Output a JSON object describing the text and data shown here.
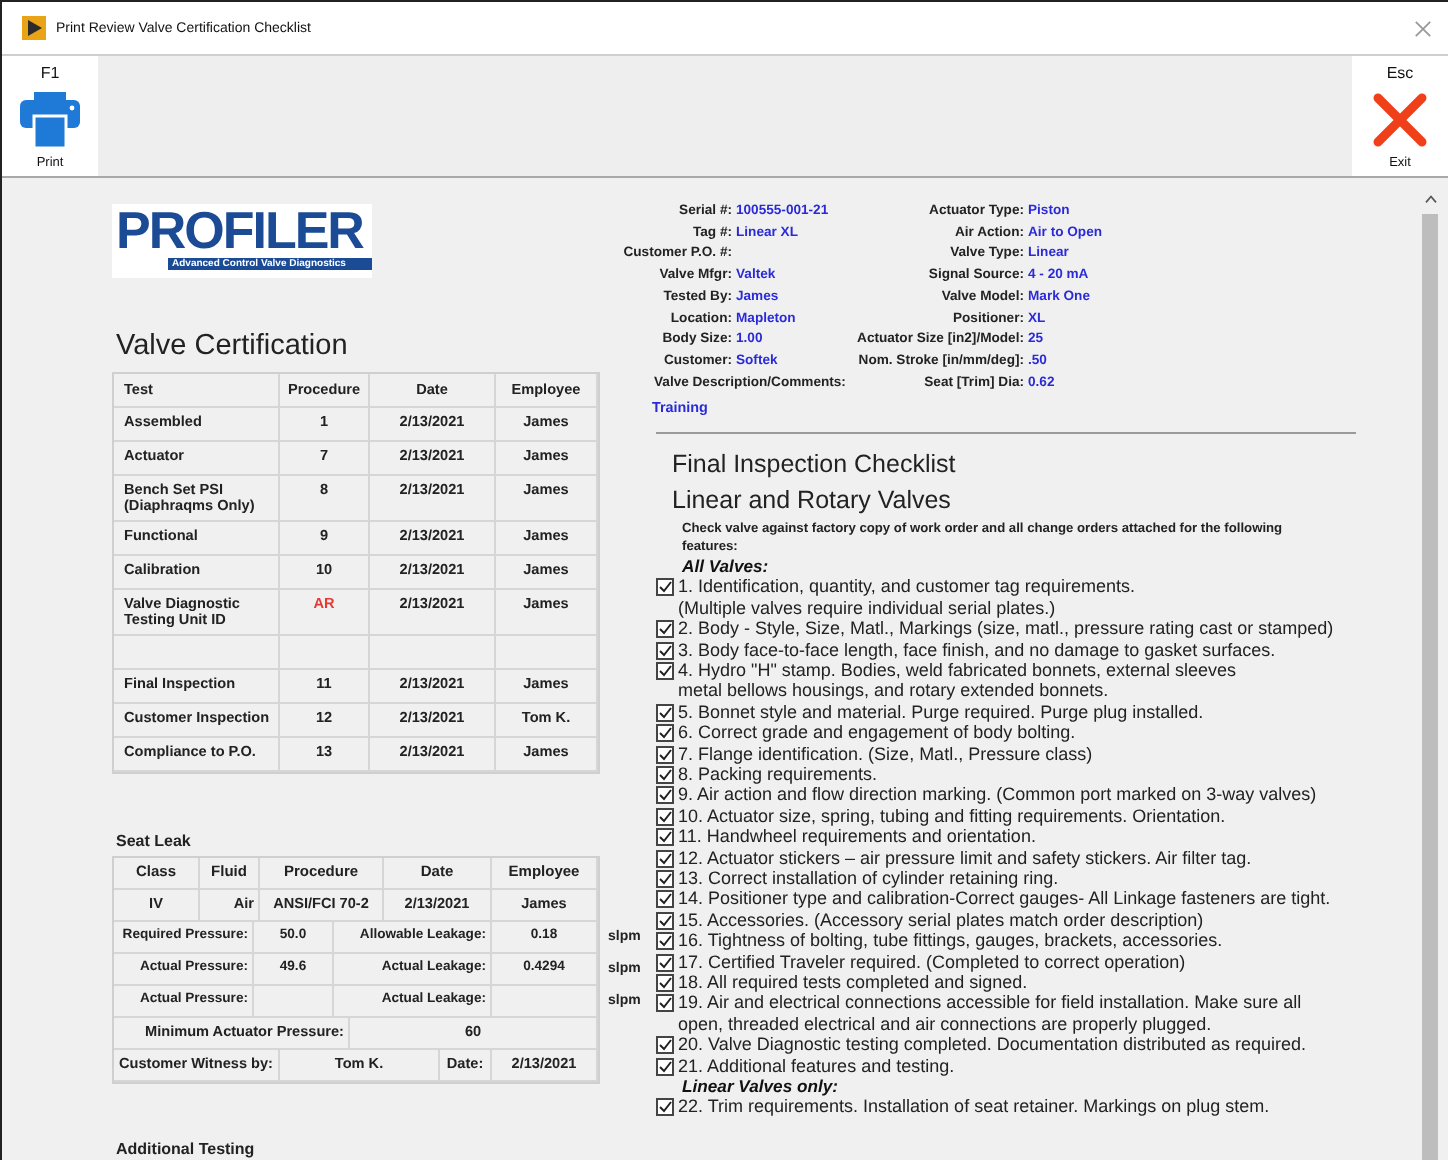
{
  "window": {
    "title": "Print Review Valve Certification Checklist"
  },
  "toolbar": {
    "buttons": [
      {
        "kind": "print",
        "key": "F1",
        "label": "Print"
      },
      {
        "kind": "exit",
        "key": "Esc",
        "label": "Exit"
      }
    ]
  },
  "logo": {
    "name": "PROFILER",
    "tagline": "Advanced Control Valve Diagnostics"
  },
  "certification": {
    "title": "Valve Certification",
    "columns": [
      "Test",
      "Procedure",
      "Date",
      "Employee"
    ],
    "rows": [
      {
        "kind": "entry",
        "test": "Assembled",
        "procedure": "1",
        "date": "2/13/2021",
        "employee": "James",
        "flagged": false
      },
      {
        "kind": "entry",
        "test": "Actuator",
        "procedure": "7",
        "date": "2/13/2021",
        "employee": "James",
        "flagged": false
      },
      {
        "kind": "entry",
        "test": "Bench Set PSI\n(Diaphraqms Only)",
        "procedure": "8",
        "date": "2/13/2021",
        "employee": "James",
        "flagged": false
      },
      {
        "kind": "entry",
        "test": "Functional",
        "procedure": "9",
        "date": "2/13/2021",
        "employee": "James",
        "flagged": false
      },
      {
        "kind": "entry",
        "test": "Calibration",
        "procedure": "10",
        "date": "2/13/2021",
        "employee": "James",
        "flagged": false
      },
      {
        "kind": "entry",
        "test": "Valve Diagnostic\nTesting Unit ID",
        "procedure": "AR",
        "date": "2/13/2021",
        "employee": "James",
        "flagged": true
      },
      {
        "kind": "blank"
      },
      {
        "kind": "entry",
        "test": "Final Inspection",
        "procedure": "11",
        "date": "2/13/2021",
        "employee": "James",
        "flagged": false
      },
      {
        "kind": "entry",
        "test": "Customer Inspection",
        "procedure": "12",
        "date": "2/13/2021",
        "employee": "Tom K.",
        "flagged": false
      },
      {
        "kind": "entry",
        "test": "Compliance to P.O.",
        "procedure": "13",
        "date": "2/13/2021",
        "employee": "James",
        "flagged": false
      }
    ]
  },
  "seat_leak": {
    "title": "Seat Leak",
    "rows": [
      {
        "kind": "header",
        "cells": [
          "Class",
          "Fluid",
          "Procedure",
          "Date",
          "Employee"
        ]
      },
      {
        "kind": "values",
        "cells": [
          "IV",
          "Air",
          "ANSI/FCI 70-2",
          "2/13/2021",
          "James"
        ]
      },
      {
        "kind": "measure",
        "label1": "Required Pressure:",
        "value1": "50.0",
        "label2": "Allowable Leakage:",
        "value2": "0.18",
        "unit": "slpm"
      },
      {
        "kind": "measure",
        "label1": "Actual Pressure:",
        "value1": "49.6",
        "label2": "Actual Leakage:",
        "value2": "0.4294",
        "unit": "slpm"
      },
      {
        "kind": "measure",
        "label1": "Actual Pressure:",
        "label2": "Actual Leakage:",
        "unit": "slpm"
      },
      {
        "kind": "minimum",
        "label": "Minimum Actuator Pressure:",
        "value": "60"
      },
      {
        "kind": "witness",
        "label": "Customer Witness by:",
        "value": "Tom K.",
        "date_label": "Date:",
        "date": "2/13/2021"
      }
    ]
  },
  "additional_testing": {
    "title": "Additional Testing"
  },
  "valve_info": {
    "rows": [
      {
        "left": {
          "label": "Serial #:",
          "value": "100555-001-21"
        },
        "right": {
          "label": "Actuator Type:",
          "value": "Piston"
        }
      },
      {
        "left": {
          "label": "Tag #:",
          "value": "Linear XL"
        },
        "right": {
          "label": "Air Action:",
          "value": "Air to Open"
        }
      },
      {
        "left": {
          "label": "Customer P.O. #:"
        },
        "right": {
          "label": "Valve Type:",
          "value": "Linear"
        }
      },
      {
        "left": {
          "label": "Valve Mfgr:",
          "value": "Valtek"
        },
        "right": {
          "label": "Signal Source:",
          "value": "4 - 20 mA"
        }
      },
      {
        "left": {
          "label": "Tested By:",
          "value": "James"
        },
        "right": {
          "label": "Valve Model:",
          "value": "Mark One"
        }
      },
      {
        "left": {
          "label": "Location:",
          "value": "Mapleton"
        },
        "right": {
          "label": "Positioner:",
          "value": "XL"
        }
      },
      {
        "left": {
          "label": "Body Size:",
          "value": "1.00"
        },
        "right": {
          "label": "Actuator Size [in2]/Model:",
          "value": "25"
        }
      },
      {
        "left": {
          "label": "Customer:",
          "value": "Softek"
        },
        "right": {
          "label": "Nom. Stroke [in/mm/deg]:",
          "value": ".50"
        }
      },
      {
        "comments_label": "Valve Description/Comments:",
        "right": {
          "label": "Seat [Trim] Dia:",
          "value": "0.62"
        }
      }
    ],
    "comments": "Training"
  },
  "checklist": {
    "title": "Final Inspection Checklist",
    "subtitle": "Linear and Rotary Valves",
    "intro": "Check valve against factory copy of work order and all change orders attached for the following features:",
    "sections": [
      {
        "heading": "All Valves:",
        "items": [
          {
            "text": "1. Identification, quantity, and customer tag requirements.\n(Multiple valves require individual serial plates.)",
            "checked": true
          },
          {
            "text": "2. Body - Style, Size, Matl., Markings (size, matl., pressure rating cast or stamped)",
            "checked": true
          },
          {
            "text": "3. Body face-to-face length, face finish, and no damage to gasket surfaces.",
            "checked": true
          },
          {
            "text": "4. Hydro \"H\" stamp. Bodies, weld fabricated bonnets, external sleeves\nmetal bellows housings, and rotary extended bonnets.",
            "checked": true
          },
          {
            "text": "5. Bonnet style and material. Purge required. Purge plug installed.",
            "checked": true
          },
          {
            "text": "6. Correct grade and engagement of body bolting.",
            "checked": true
          },
          {
            "text": "7. Flange identification. (Size, Matl., Pressure class)",
            "checked": true
          },
          {
            "text": "8. Packing requirements.",
            "checked": true
          },
          {
            "text": "9. Air action and flow direction marking. (Common port marked on 3-way valves)",
            "checked": true
          },
          {
            "text": "10. Actuator size, spring, tubing and fitting requirements. Orientation.",
            "checked": true
          },
          {
            "text": "11. Handwheel requirements and orientation.",
            "checked": true
          },
          {
            "text": "12. Actuator stickers – air pressure limit and safety stickers. Air filter tag.",
            "checked": true
          },
          {
            "text": "13. Correct installation of cylinder retaining ring.",
            "checked": true
          },
          {
            "text": "14. Positioner type and calibration-Correct gauges- All Linkage fasteners are tight.",
            "checked": true
          },
          {
            "text": "15. Accessories. (Accessory serial plates match order description)",
            "checked": true
          },
          {
            "text": "16. Tightness of bolting, tube fittings, gauges, brackets, accessories.",
            "checked": true
          },
          {
            "text": "17. Certified Traveler required. (Completed to correct operation)",
            "checked": true
          },
          {
            "text": "18. All required tests completed and signed.",
            "checked": true
          },
          {
            "text": "19. Air and electrical connections accessible for field installation. Make sure all\nopen, threaded electrical and air connections are properly plugged.",
            "checked": true
          },
          {
            "text": "20. Valve Diagnostic testing completed. Documentation distributed as required.",
            "checked": true
          },
          {
            "text": "21. Additional features and testing.",
            "checked": true
          }
        ]
      },
      {
        "heading": "Linear Valves only:",
        "items": [
          {
            "text": "22. Trim requirements. Installation of seat retainer. Markings on plug stem.",
            "checked": true
          }
        ]
      }
    ]
  }
}
